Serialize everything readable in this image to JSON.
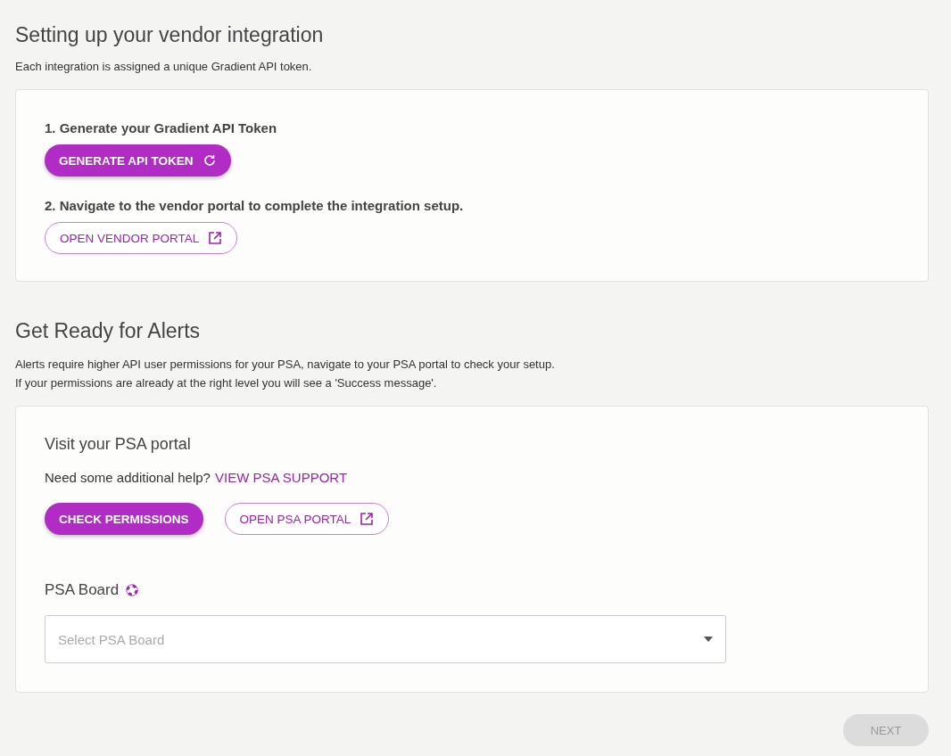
{
  "vendor_section": {
    "title": "Setting up your vendor integration",
    "description": "Each integration is assigned a unique Gradient API token.",
    "steps": [
      {
        "label": "1. Generate your Gradient API Token",
        "button": {
          "label": "GENERATE API TOKEN",
          "kind": "primary"
        }
      },
      {
        "label": "2. Navigate to the vendor portal to complete the integration setup.",
        "button": {
          "label": "OPEN VENDOR PORTAL",
          "kind": "outline"
        }
      }
    ]
  },
  "alerts_section": {
    "title": "Get Ready for Alerts",
    "description_lines": [
      "Alerts require higher API user permissions for your PSA, navigate to your PSA portal to check your setup.",
      "If your permissions are already at the right level you will see a 'Success message'."
    ],
    "card_title": "Visit your PSA portal",
    "help_text": "Need some additional help?",
    "help_link": "VIEW PSA SUPPORT",
    "buttons": [
      {
        "label": "CHECK PERMISSIONS",
        "kind": "primary"
      },
      {
        "label": "OPEN PSA PORTAL",
        "kind": "outline"
      }
    ],
    "board_label": "PSA Board",
    "board_select": {
      "placeholder": "Select PSA Board"
    }
  },
  "next_button": {
    "label": "NEXT",
    "disabled": true
  }
}
